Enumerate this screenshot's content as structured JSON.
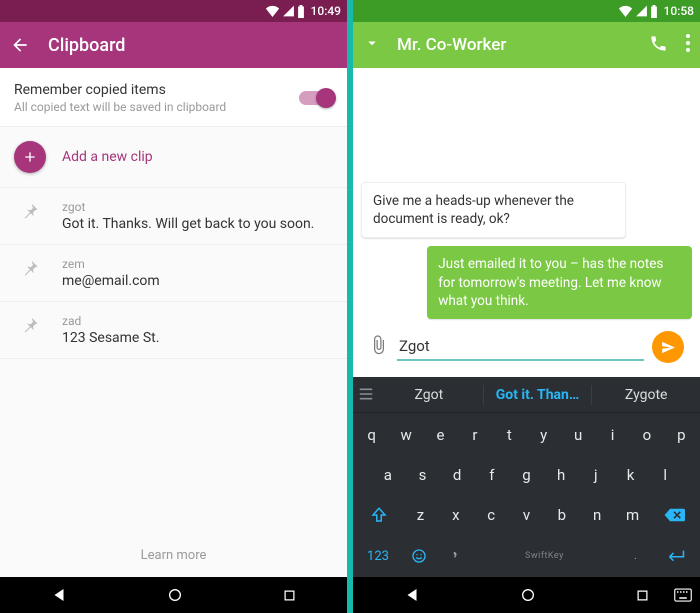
{
  "left": {
    "status": {
      "time": "10:49"
    },
    "header": {
      "title": "Clipboard"
    },
    "setting": {
      "label": "Remember copied items",
      "sub": "All copied text will be saved in clipboard",
      "enabled": true
    },
    "add_label": "Add a new clip",
    "clips": [
      {
        "key": "zgot",
        "value": "Got it. Thanks. Will get back to you soon."
      },
      {
        "key": "zem",
        "value": "me@email.com"
      },
      {
        "key": "zad",
        "value": "123 Sesame St."
      }
    ],
    "learn_more": "Learn more"
  },
  "right": {
    "status": {
      "time": "10:58"
    },
    "header": {
      "title": "Mr. Co-Worker"
    },
    "messages": {
      "incoming": "Give me a heads-up whenever the document is ready, ok?",
      "outgoing": "Just emailed it to you – has the notes for tomorrow's meeting. Let me know what you think."
    },
    "compose": {
      "value": "Zgot"
    },
    "keyboard": {
      "suggestions": [
        "Zgot",
        "Got it. Than…",
        "Zygote"
      ],
      "active_suggestion": 1,
      "rows": [
        [
          "q",
          "w",
          "e",
          "r",
          "t",
          "y",
          "u",
          "i",
          "o",
          "p"
        ],
        [
          "a",
          "s",
          "d",
          "f",
          "g",
          "h",
          "j",
          "k",
          "l"
        ],
        [
          "z",
          "x",
          "c",
          "v",
          "b",
          "n",
          "m"
        ]
      ],
      "num_label": "123",
      "space_label": "SwiftKey"
    }
  },
  "colors": {
    "clipboard_primary": "#a6357c",
    "messenger_primary": "#7ac843",
    "send_button": "#ff9800",
    "kb_accent": "#29b6f6"
  }
}
